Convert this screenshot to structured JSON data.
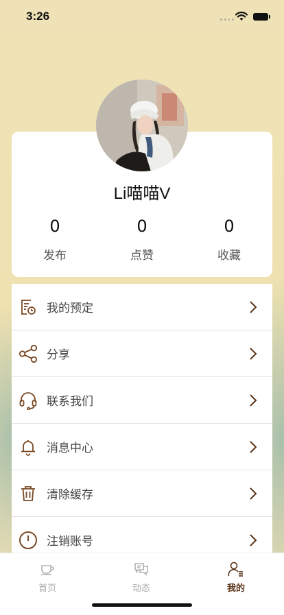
{
  "status_bar": {
    "time": "3:26",
    "signal_icon": "signal-dots-icon",
    "wifi_icon": "wifi-icon",
    "battery_icon": "battery-icon"
  },
  "profile": {
    "username": "Li喵喵V",
    "stats": [
      {
        "value": "0",
        "label": "发布"
      },
      {
        "value": "0",
        "label": "点赞"
      },
      {
        "value": "0",
        "label": "收藏"
      }
    ]
  },
  "menu": {
    "items": [
      {
        "label": "我的预定",
        "icon": "booking-icon"
      },
      {
        "label": "分享",
        "icon": "share-icon"
      },
      {
        "label": "联系我们",
        "icon": "headset-icon"
      },
      {
        "label": "消息中心",
        "icon": "bell-icon"
      },
      {
        "label": "清除缓存",
        "icon": "trash-icon"
      },
      {
        "label": "注销账号",
        "icon": "power-icon"
      }
    ]
  },
  "tabbar": {
    "items": [
      {
        "label": "首页",
        "icon": "coffee-cup-icon",
        "active": false
      },
      {
        "label": "动态",
        "icon": "chat-bubbles-icon",
        "active": false
      },
      {
        "label": "我的",
        "icon": "user-icon",
        "active": true
      }
    ]
  },
  "colors": {
    "accent": "#5a3418",
    "icon": "#7a4a25",
    "background_top": "#efe1b2",
    "background_side": "#a5beaa"
  }
}
